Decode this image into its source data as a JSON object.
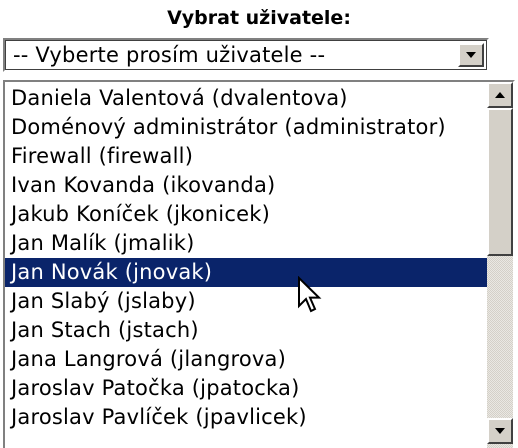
{
  "title": "Vybrat uživatele:",
  "select": {
    "value": "-- Vyberte prosím uživatele --"
  },
  "list": {
    "items": [
      {
        "label": "Daniela Valentová (dvalentova)"
      },
      {
        "label": "Doménový administrátor (administrator)"
      },
      {
        "label": "Firewall (firewall)"
      },
      {
        "label": "Ivan Kovanda (ikovanda)"
      },
      {
        "label": "Jakub Koníček (jkonicek)"
      },
      {
        "label": "Jan Malík (jmalik)"
      },
      {
        "label": "Jan Novák (jnovak)",
        "selected": true
      },
      {
        "label": "Jan Slabý (jslaby)"
      },
      {
        "label": "Jan Stach (jstach)"
      },
      {
        "label": "Jana Langrová (jlangrova)"
      },
      {
        "label": "Jaroslav Patočka (jpatocka)"
      },
      {
        "label": "Jaroslav Pavlíček (jpavlicek)"
      }
    ]
  },
  "colors": {
    "selection_background": "#0a246a",
    "selection_text": "#ffffff",
    "control_face": "#d4d0c8"
  },
  "icons": {
    "dropdown": "chevron-down-icon",
    "scroll_up": "scroll-up-arrow-icon",
    "scroll_down": "scroll-down-arrow-icon",
    "cursor": "mouse-pointer-icon"
  }
}
